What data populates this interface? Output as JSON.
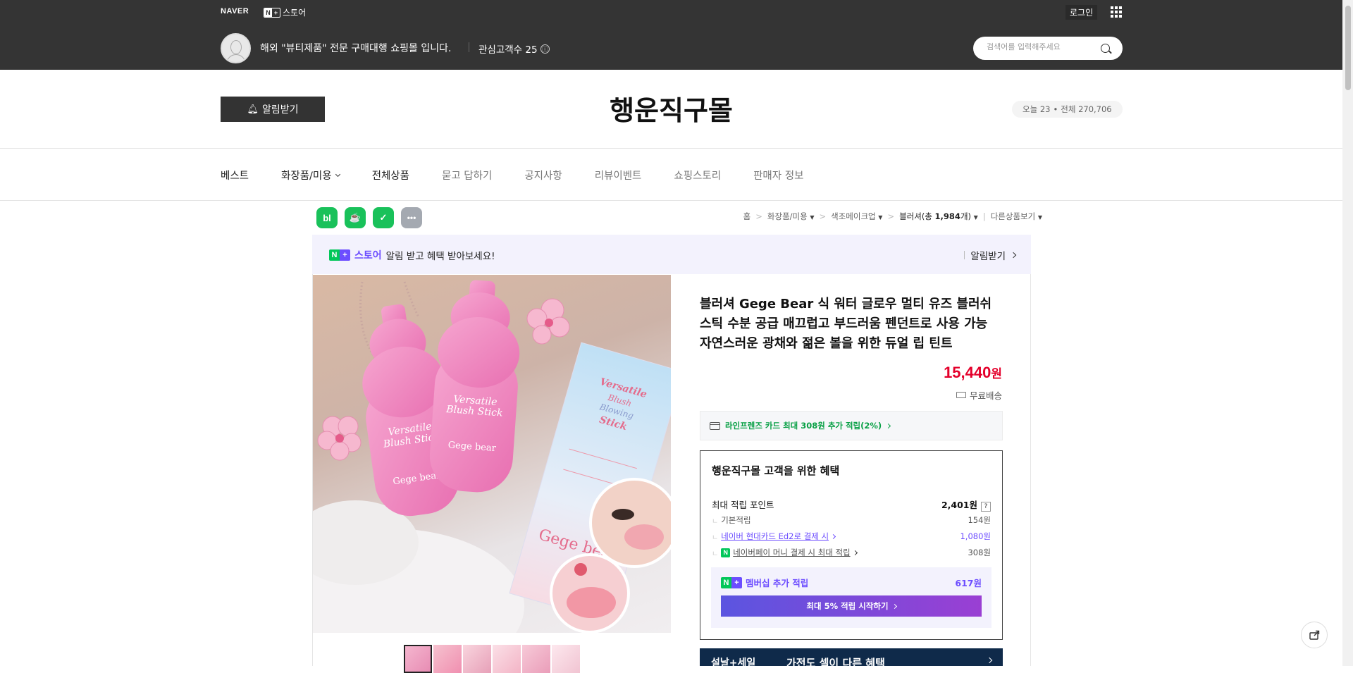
{
  "header": {
    "naver_brand": "NAVER",
    "np_n": "N",
    "np_plus": "+",
    "np_store": "스토어",
    "login": "로그인",
    "store_desc": "해외 \"뷰티제품\" 전문 구매대행 쇼핑몰 입니다.",
    "fav_label": "관심고객수 25",
    "info_icon": "ⓘ",
    "search_placeholder": "검색어를 입력해주세요"
  },
  "store": {
    "alert_btn": "알림받기",
    "title": "행운직구몰",
    "today": "오늘 23",
    "dot": "•",
    "total": "전체 270,706"
  },
  "nav": {
    "items": [
      "베스트",
      "화장품/미용",
      "전체상품",
      "묻고 답하기",
      "공지사항",
      "리뷰이벤트",
      "쇼핑스토리",
      "판매자 정보"
    ]
  },
  "share": {
    "blog": "bl",
    "cafe": "☕",
    "band": "✓",
    "more": "•••"
  },
  "breadcrumb": {
    "home": "홈",
    "cat1": "화장품/미용",
    "cat2": "색조메이크업",
    "cat3_prefix": "블러셔(총 ",
    "cat3_count": "1,984",
    "cat3_suffix": "개)",
    "other": "다른상품보기",
    "sep": ">"
  },
  "promo": {
    "n": "N",
    "plus": "+",
    "store": "스토어",
    "text": "알림 받고 혜택 받아보세요!",
    "btn": "알림받기"
  },
  "product": {
    "image_texts": {
      "bottle1_line1": "Versatile",
      "bottle1_line2": "Blush Stick",
      "bottle1_brand": "Gege bear",
      "bottle2_line1": "Versatile",
      "bottle2_line2": "Blush Stick",
      "bottle2_brand": "Gege bear",
      "box_line1": "Versatile",
      "box_line2": "Blush",
      "box_line3": "Blowing",
      "box_line4": "Stick",
      "box_brand": "Gege bear"
    },
    "title": "블러셔 Gege Bear 식 워터 글로우 멀티 유즈 블러쉬 스틱 수분 공급 매끄럽고 부드러움 펜던트로 사용 가능 자연스러운 광채와 젊은 볼을 위한 듀얼 립 틴트",
    "price": "15,440",
    "won": "원",
    "shipping": "무료배송",
    "card_benefit": "라인프렌즈 카드 최대 308원 추가 적립(2%)"
  },
  "benefit": {
    "title": "행운직구몰 고객을 위한 혜택",
    "max_label": "최대 적립 포인트",
    "max_value": "2,401원",
    "q": "?",
    "tree": "ㄴ",
    "basic_label": "기본적립",
    "basic_value": "154원",
    "card_label": "네이버 현대카드 Ed2로 결제 시",
    "card_value": "1,080원",
    "npay_label": "네이버페이 머니 결제 시 최대 적립",
    "npay_value": "308원",
    "npay_icon": "N",
    "member_label": "멤버십 추가 적립",
    "member_value": "617원",
    "member_btn": "최대 5% 적립 시작하기"
  },
  "banner": {
    "t1": "설날+세일",
    "t2": "가전도 셀이 다른 혜택"
  },
  "colors": {
    "header_bg": "#343434",
    "price": "#e4002b",
    "naver_green": "#03c75a",
    "plus_purple": "#6c4dff"
  }
}
